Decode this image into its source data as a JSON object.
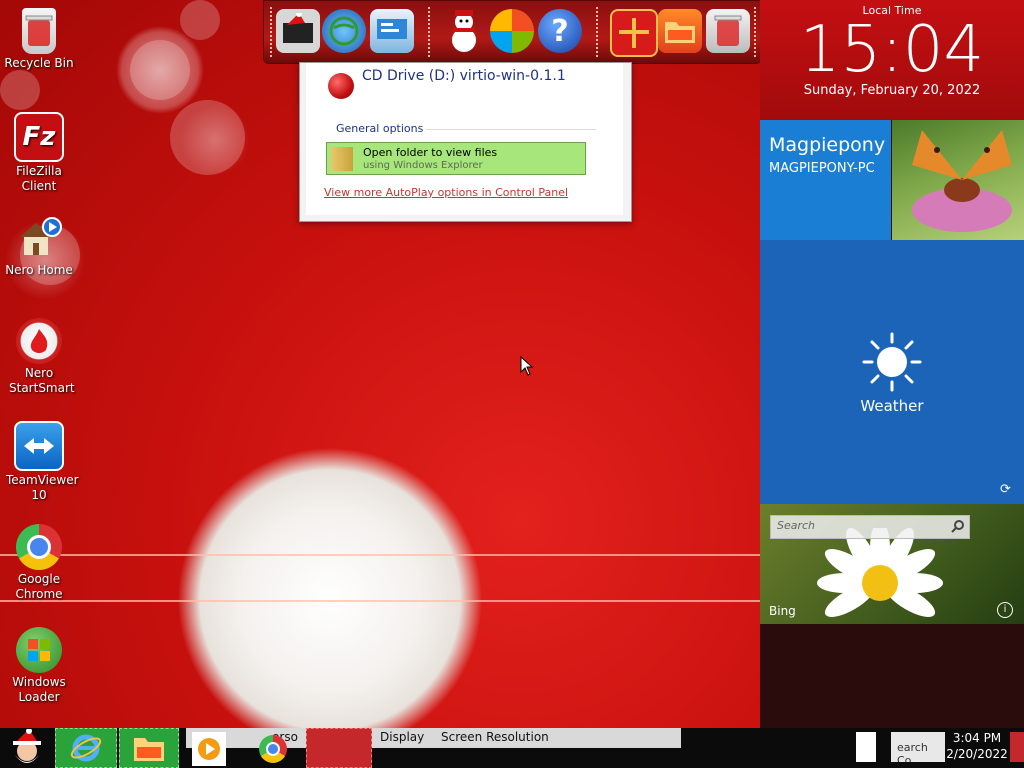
{
  "desktop_icons": [
    {
      "label": "Recycle Bin",
      "icon": "recycle-bin-icon"
    },
    {
      "label": "FileZilla Client",
      "icon": "filezilla-icon"
    },
    {
      "label": "Nero Home",
      "icon": "nero-home-icon"
    },
    {
      "label": "Nero StartSmart",
      "icon": "nero-startsmart-icon"
    },
    {
      "label": "TeamViewer 10",
      "icon": "teamviewer-icon"
    },
    {
      "label": "Google Chrome",
      "icon": "chrome-icon"
    },
    {
      "label": "Windows Loader",
      "icon": "windows-loader-icon"
    }
  ],
  "dock": {
    "icons": [
      "santa-computer-icon",
      "globe-computer-icon",
      "control-panel-icon",
      "snowman-icon",
      "windows-ball-icon",
      "help-icon",
      "gift-icon",
      "folder-icon",
      "trash-icon"
    ],
    "help_glyph": "?"
  },
  "autoplay": {
    "title": "CD Drive (D:) virtio-win-0.1.1",
    "section": "General options",
    "option_title": "Open folder to view files",
    "option_subtitle": "using Windows Explorer",
    "link": "View more AutoPlay options in Control Panel"
  },
  "clock": {
    "heading": "Local Time",
    "time": "15:04",
    "date": "Sunday, February 20, 2022"
  },
  "user_tile": {
    "name": "Magpiepony",
    "machine": "MAGPIEPONY-PC"
  },
  "weather_tile": {
    "label": "Weather"
  },
  "bing_tile": {
    "search_placeholder": "Search",
    "label": "Bing",
    "info_glyph": "i"
  },
  "taskbar": {
    "strip_items": [
      "erso",
      "Display",
      "Screen Resolution"
    ],
    "tray_text": "earch Co",
    "time": "3:04 PM",
    "date": "2/20/2022"
  },
  "colors": {
    "accent_red": "#c40f12",
    "weather_blue": "#1c64b8",
    "user_blue": "#1a7fd4",
    "option_green": "#a6e67a",
    "link_red": "#c0392b"
  }
}
